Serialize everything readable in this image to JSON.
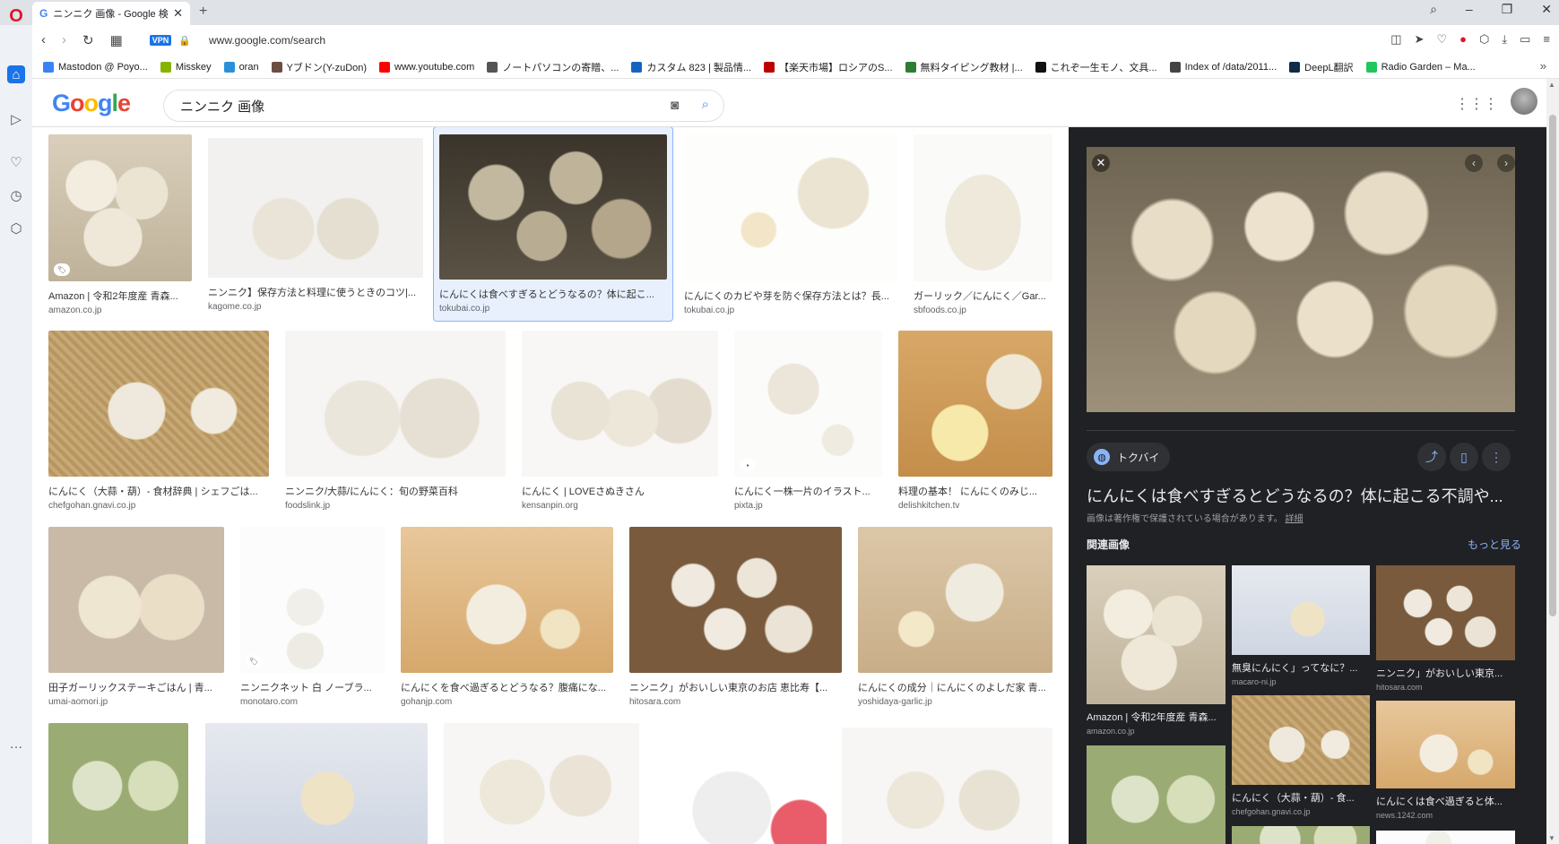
{
  "browser": {
    "tab_title": "ニンニク 画像 - Google 検索",
    "url": "www.google.com/search",
    "vpn_label": "VPN"
  },
  "bookmarks": [
    {
      "label": "Mastodon @ Poyo...",
      "color": "#3b82f6"
    },
    {
      "label": "Misskey",
      "color": "#86b300"
    },
    {
      "label": "oran",
      "color": "#2b90d9"
    },
    {
      "label": "Yブドン(Y-zuDon)",
      "color": "#6d4c41"
    },
    {
      "label": "www.youtube.com",
      "color": "#ff0000"
    },
    {
      "label": "ノートパソコンの寄贈、...",
      "color": "#555555"
    },
    {
      "label": "カスタム 823 | 製品情...",
      "color": "#1565c0"
    },
    {
      "label": "【楽天市場】ロシアのS...",
      "color": "#bf0000"
    },
    {
      "label": "無料タイピング教材 |...",
      "color": "#2e7d32"
    },
    {
      "label": "これぞ一生モノ、文具...",
      "color": "#111111"
    },
    {
      "label": "Index of /data/2011...",
      "color": "#444444"
    },
    {
      "label": "DeepL翻訳",
      "color": "#0f2b46"
    },
    {
      "label": "Radio Garden – Ma...",
      "color": "#22c55e"
    }
  ],
  "search": {
    "query": "ニンニク 画像",
    "logo": "Google"
  },
  "results": [
    {
      "title": "Amazon | 令和2年度産 青森...",
      "domain": "amazon.co.jp"
    },
    {
      "title": "ニンニク】保存方法と料理に使うときのコツ|...",
      "domain": "kagome.co.jp"
    },
    {
      "title": "にんにくは食べすぎるとどうなるの？体に起こ...",
      "domain": "tokubai.co.jp"
    },
    {
      "title": "にんにくのカビや芽を防ぐ保存方法とは？長...",
      "domain": "tokubai.co.jp"
    },
    {
      "title": "ガーリック／にんにく／Gar...",
      "domain": "sbfoods.co.jp"
    },
    {
      "title": "にんにく（大蒜・葫）- 食材辞典 | シェフごは...",
      "domain": "chefgohan.gnavi.co.jp"
    },
    {
      "title": "ニンニク/大蒜/にんにく：旬の野菜百科",
      "domain": "foodslink.jp"
    },
    {
      "title": "にんにく | LOVEさぬきさん",
      "domain": "kensanpin.org"
    },
    {
      "title": "にんにく一株一片のイラスト...",
      "domain": "pixta.jp"
    },
    {
      "title": "料理の基本！ にんにくのみじ...",
      "domain": "delishkitchen.tv"
    },
    {
      "title": "田子ガーリックステーキごはん | 青...",
      "domain": "umai-aomori.jp"
    },
    {
      "title": "ニンニクネット 白 ノーブラ...",
      "domain": "monotaro.com"
    },
    {
      "title": "にんにくを食べ過ぎるとどうなる？腹痛にな...",
      "domain": "gohanjp.com"
    },
    {
      "title": "ニンニク」がおいしい東京のお店 恵比寿【...",
      "domain": "hitosara.com"
    },
    {
      "title": "にんにくの成分｜にんにくのよしだ家 青...",
      "domain": "yoshidaya-garlic.jp"
    }
  ],
  "preview": {
    "source_name": "トクバイ",
    "title": "にんにくは食べすぎるとどうなるの？体に起こる不調や...",
    "copyright": "画像は著作権で保護されている場合があります。",
    "copyright_link": "詳細",
    "related_label": "関連画像",
    "more_label": "もっと見る",
    "related": [
      {
        "title": "Amazon | 令和2年度産 青森...",
        "domain": "amazon.co.jp"
      },
      {
        "title": "無臭にんにく」ってなに？...",
        "domain": "macaro-ni.jp"
      },
      {
        "title": "ニンニク」がおいしい東京...",
        "domain": "hitosara.com"
      },
      {
        "title": "にんにく（大蒜・葫）- 食...",
        "domain": "chefgohan.gnavi.co.jp"
      },
      {
        "title": "にんにくは食べ過ぎると体...",
        "domain": "news.1242.com"
      }
    ]
  }
}
